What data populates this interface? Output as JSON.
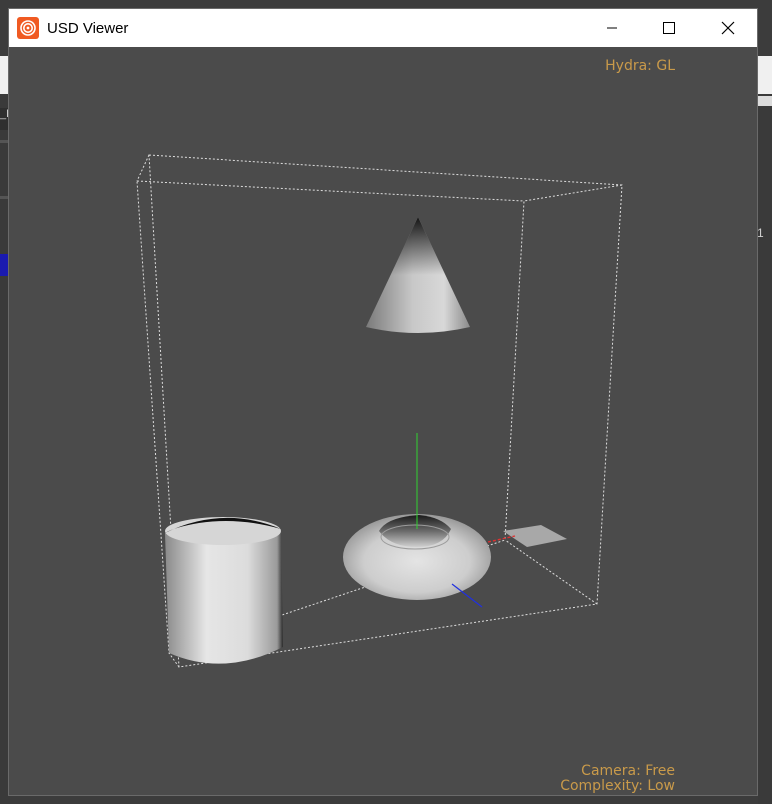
{
  "window": {
    "title": "USD Viewer",
    "icon": "houdini-logo-icon",
    "controls": {
      "minimize": "minimize-icon",
      "maximize": "maximize-icon",
      "close": "close-icon"
    }
  },
  "viewport": {
    "renderer_label": "Hydra: GL",
    "camera_label": "Camera: Free",
    "complexity_label": "Complexity: Low",
    "hud_color": "#c99a4a",
    "background": "#4b4b4b"
  },
  "scene": {
    "objects": [
      "cone",
      "torus",
      "cylinder",
      "plane"
    ],
    "bounding_box": true,
    "axes": {
      "x": "#e03030",
      "y": "#30d030",
      "z": "#2030e0"
    }
  },
  "background_app": {
    "left_tab_text": "_H",
    "right_number": "1"
  }
}
